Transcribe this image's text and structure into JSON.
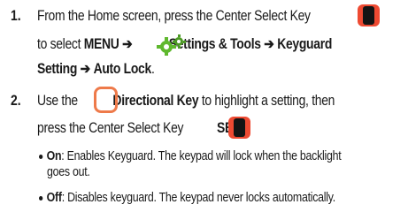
{
  "steps": [
    {
      "number": "1.",
      "lines": [
        {
          "text_a": "From the Home screen, press the Center Select Key"
        },
        {
          "prefix": "to select ",
          "menu": "MENU",
          "arrow1": "➔",
          "settings": "Settings & Tools",
          "arrow2": "➔",
          "keyguard": "Keyguard"
        },
        {
          "setting": "Setting",
          "arrow": "➔",
          "autolock": "Auto Lock",
          "period": "."
        }
      ]
    },
    {
      "number": "2.",
      "lines": [
        {
          "prefix": "Use the",
          "dirkey": "Directional Key",
          "suffix": "to highlight a setting, then"
        },
        {
          "text": "press the Center Select Key",
          "set": "SET",
          "colon": ":"
        }
      ]
    }
  ],
  "bullets": [
    {
      "label": "On",
      "line1": ": Enables Keyguard. The keypad will lock when the backlight",
      "line2": "goes out."
    },
    {
      "label": "Off",
      "line1": ": Disables keyguard. The keypad never locks automatically."
    }
  ],
  "icons": {
    "center_select_key": "center-select-key-icon",
    "settings_gear": "settings-gear-icon",
    "directional_key": "directional-key-icon"
  },
  "colors": {
    "key_orange": "#ee4a32",
    "key_outline": "#ee7a4a",
    "gear_green": "#5fb82e"
  }
}
